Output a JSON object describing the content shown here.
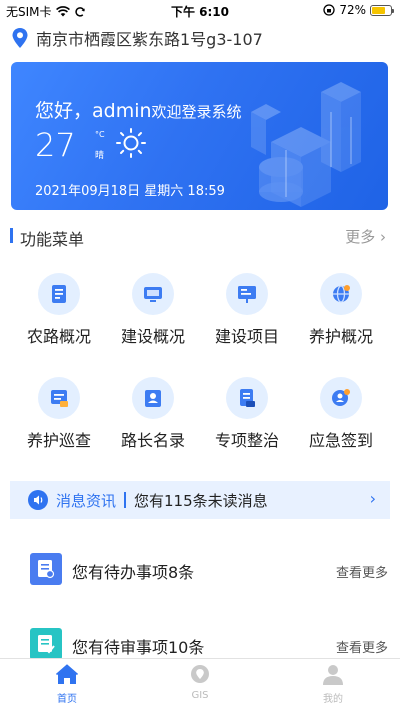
{
  "status_bar": {
    "carrier": "无SIM卡",
    "time": "下午 6:10",
    "battery": "72%",
    "battery_level": 0.72
  },
  "location": {
    "address": "南京市栖霞区紫东路1号g3-107"
  },
  "hero": {
    "greeting": "您好，admin",
    "greeting_rest": "欢迎登录系统",
    "temperature": "27",
    "temp_unit": "°C",
    "condition": "晴",
    "datetime": "2021年09月18日  星期六  18:59"
  },
  "menu_section": {
    "title": "功能菜单",
    "more": "更多"
  },
  "menu_items": [
    {
      "label": "农路概况",
      "icon": "report-icon"
    },
    {
      "label": "建设概况",
      "icon": "monitor-icon"
    },
    {
      "label": "建设项目",
      "icon": "presentation-icon"
    },
    {
      "label": "养护概况",
      "icon": "globe-icon"
    },
    {
      "label": "养护巡查",
      "icon": "inspection-icon"
    },
    {
      "label": "路长名录",
      "icon": "roster-icon"
    },
    {
      "label": "专项整治",
      "icon": "document-icon"
    },
    {
      "label": "应急签到",
      "icon": "emergency-icon"
    }
  ],
  "message_bar": {
    "label": "消息资讯",
    "text": "您有115条未读消息"
  },
  "pending": [
    {
      "text": "您有待办事项8条",
      "more": "查看更多",
      "color": "#4a7cf0"
    },
    {
      "text": "您有待审事项10条",
      "more": "查看更多",
      "color": "#27c4c4"
    }
  ],
  "tabs": [
    {
      "label": "首页",
      "active": true
    },
    {
      "label": "GIS",
      "active": false
    },
    {
      "label": "我的",
      "active": false
    }
  ],
  "colors": {
    "accent": "#2f73f0",
    "inactive": "#bbbbbb"
  }
}
